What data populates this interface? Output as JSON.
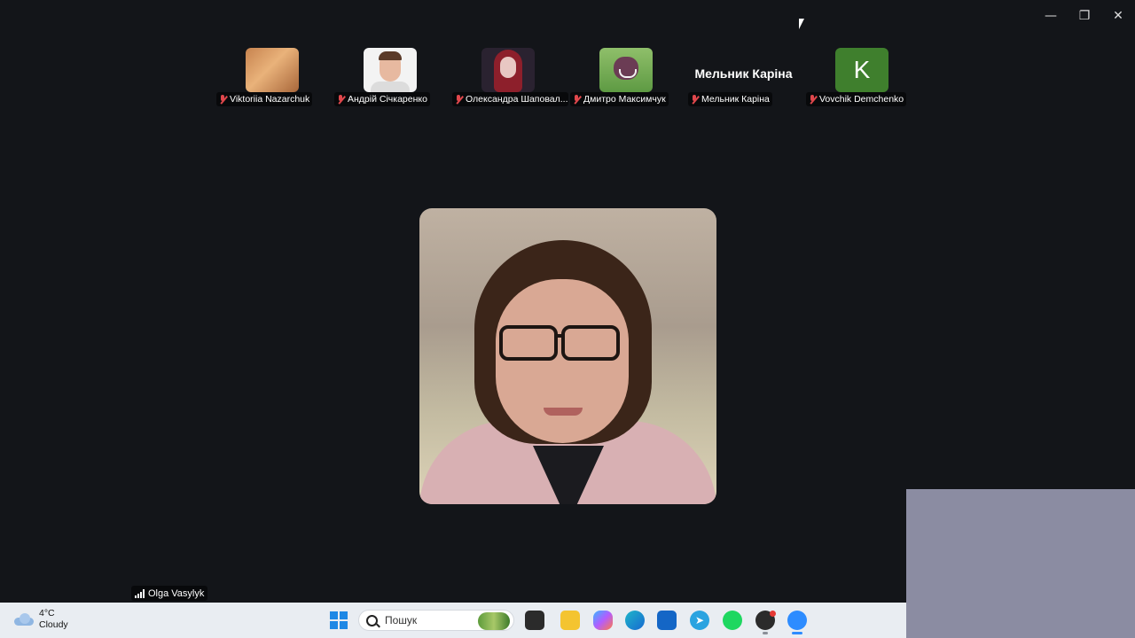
{
  "window": {
    "controls": [
      "minimize",
      "restore",
      "close"
    ]
  },
  "participants": [
    {
      "name": "Viktoriia Nazarchuk",
      "muted": true,
      "avatar": "cat-photo"
    },
    {
      "name": "Андрій Січкаренко",
      "muted": true,
      "avatar": "person-photo"
    },
    {
      "name": "Олександра Шаповал...",
      "muted": true,
      "avatar": "person-photo"
    },
    {
      "name": "Дмитро Максимчук",
      "muted": true,
      "avatar": "boar-illustration"
    },
    {
      "name": "Мельник Каріна",
      "muted": true,
      "avatar": "name-text",
      "display_name": "Мельник Каріна"
    },
    {
      "name": "Vovchik Demchenko",
      "muted": true,
      "avatar": "letter",
      "letter": "K",
      "color": "#3f7f2d"
    }
  ],
  "active_speaker": {
    "name": "Olga Vasylyk"
  },
  "taskbar": {
    "weather": {
      "temp": "4°C",
      "condition": "Cloudy"
    },
    "search_placeholder": "Пошук",
    "apps": [
      "windows-start",
      "file-manager",
      "file-explorer",
      "copilot",
      "edge",
      "microsoft-store",
      "telegram",
      "spotify",
      "obs",
      "zoom"
    ],
    "accent": "#2d8cff"
  }
}
